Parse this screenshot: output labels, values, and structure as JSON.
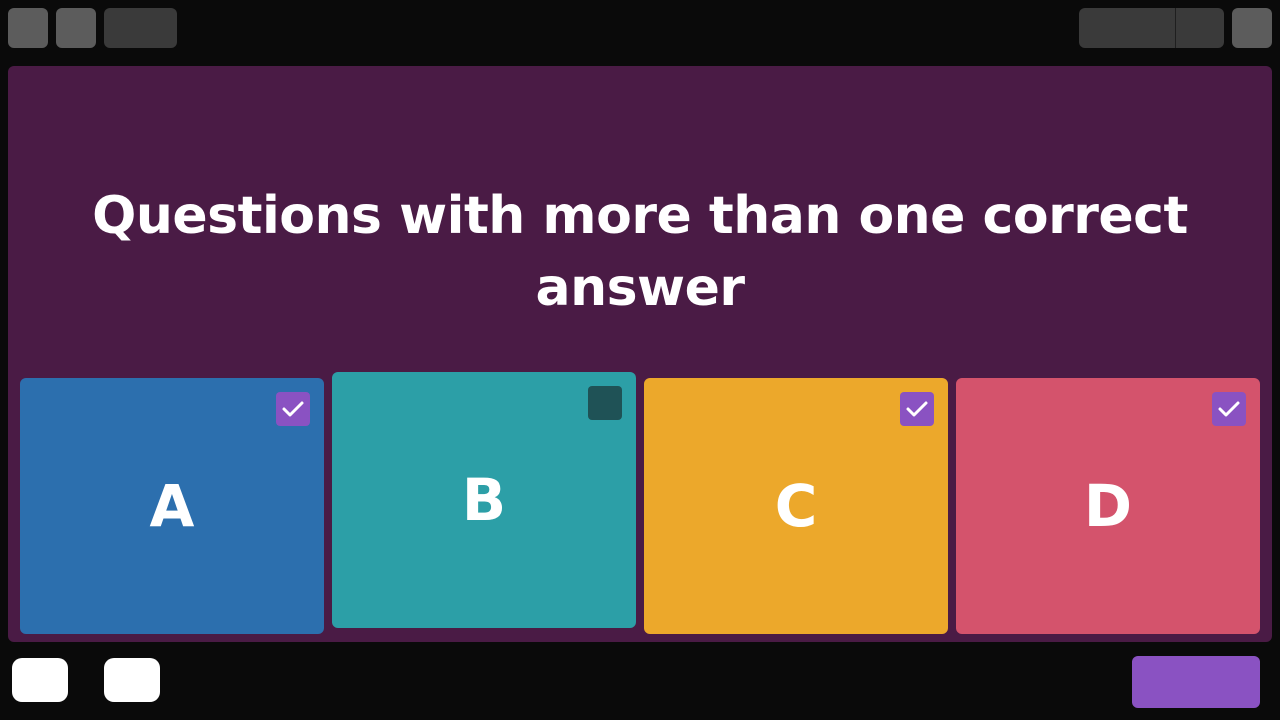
{
  "question": {
    "title": "Questions with more than one correct answer"
  },
  "colors": {
    "background": "#0a0a0a",
    "panel": "#4a1b45",
    "checkbox_checked": "#8a52c2",
    "checkbox_unchecked": "#1f5256",
    "submit_button": "#8a52c2"
  },
  "answers": [
    {
      "letter": "A",
      "color": "#2c6fae",
      "checked": true,
      "checkbox_icon": "check-icon"
    },
    {
      "letter": "B",
      "color": "#2c9fa7",
      "checked": false,
      "checkbox_icon": "empty-checkbox"
    },
    {
      "letter": "C",
      "color": "#eca82b",
      "checked": true,
      "checkbox_icon": "check-icon"
    },
    {
      "letter": "D",
      "color": "#d4536c",
      "checked": true,
      "checkbox_icon": "check-icon"
    }
  ]
}
